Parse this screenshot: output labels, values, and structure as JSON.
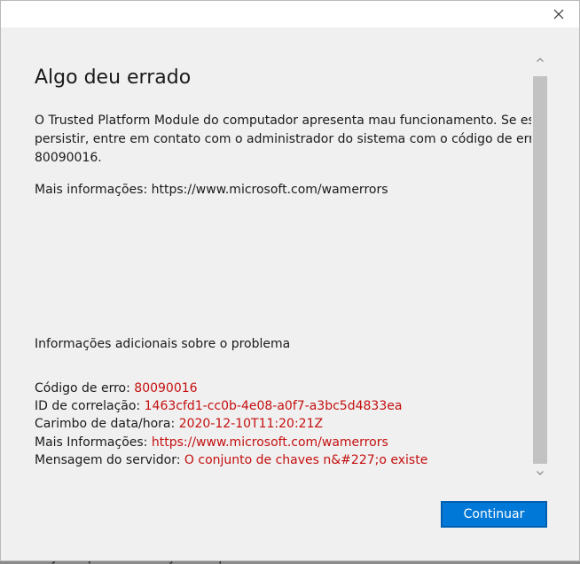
{
  "background": {
    "peek_text": "Ajuda para a solução de problemas"
  },
  "dialog": {
    "close_icon": "close-icon",
    "heading": "Algo deu errado",
    "message_lines": [
      "O Trusted Platform Module do computador apresenta mau funcionamento. Se esse erro",
      "persistir, entre em contato com o administrador do sistema com o código de erro",
      "80090016."
    ],
    "more_info": "Mais informações: https://www.microsoft.com/wamerrors",
    "additional_heading": "Informações adicionais sobre o problema",
    "details": [
      {
        "label": "Código de erro: ",
        "value": "80090016"
      },
      {
        "label": "ID de correlação: ",
        "value": "1463cfd1-cc0b-4e08-a0f7-a3bc5d4833ea"
      },
      {
        "label": "Carimbo de data/hora: ",
        "value": "2020-12-10T11:20:21Z"
      },
      {
        "label": "Mais Informações: ",
        "value": "https://www.microsoft.com/wamerrors"
      },
      {
        "label": "Mensagem do servidor: ",
        "value": "O conjunto de chaves n&#227;o existe"
      }
    ],
    "continue_label": "Continuar"
  },
  "colors": {
    "accent": "#0078d7",
    "error_value": "#c50f0f",
    "dialog_bg": "#f0f0f0",
    "scroll_thumb": "#c2c2c2"
  }
}
